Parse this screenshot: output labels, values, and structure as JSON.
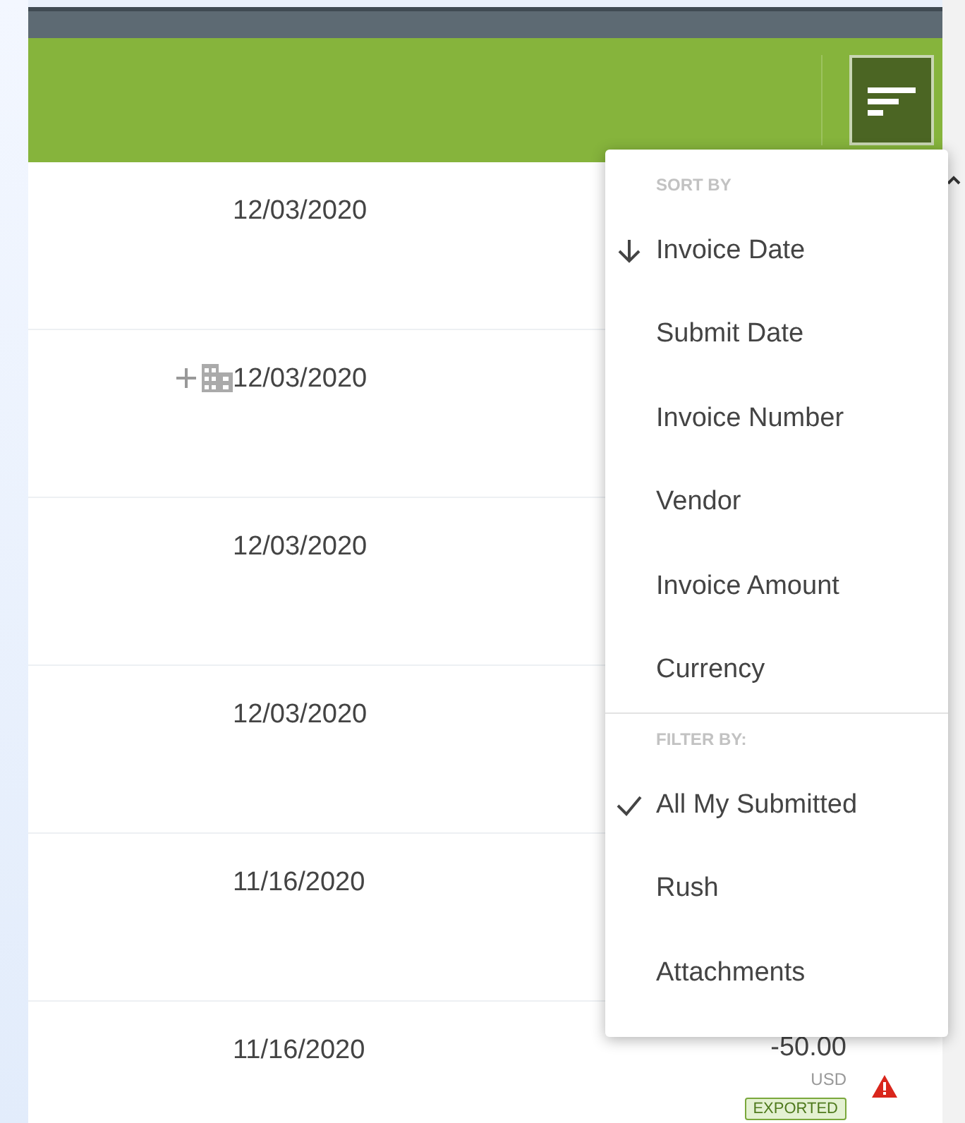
{
  "header": {
    "sort_button": {
      "open": true
    }
  },
  "rows": [
    {
      "date": "12/03/2020",
      "add_vendor": false
    },
    {
      "date": "12/03/2020",
      "add_vendor": true
    },
    {
      "date": "12/03/2020",
      "add_vendor": false
    },
    {
      "date": "12/03/2020",
      "add_vendor": false
    },
    {
      "date": "11/16/2020",
      "add_vendor": false
    },
    {
      "date": "11/16/2020",
      "add_vendor": false,
      "amount": "-50.00",
      "currency": "USD",
      "warning": true,
      "status": "EXPORTED"
    }
  ],
  "menu": {
    "sections": [
      {
        "heading": "SORT BY",
        "kind": "sort",
        "items": [
          {
            "label": "Invoice Date",
            "selected": true
          },
          {
            "label": "Submit Date",
            "selected": false
          },
          {
            "label": "Invoice Number",
            "selected": false
          },
          {
            "label": "Vendor",
            "selected": false
          },
          {
            "label": "Invoice Amount",
            "selected": false
          },
          {
            "label": "Currency",
            "selected": false
          }
        ]
      },
      {
        "heading": "FILTER BY:",
        "kind": "filter",
        "items": [
          {
            "label": "All My Submitted",
            "selected": true
          },
          {
            "label": "Rush",
            "selected": false
          },
          {
            "label": "Attachments",
            "selected": false
          }
        ]
      }
    ]
  }
}
